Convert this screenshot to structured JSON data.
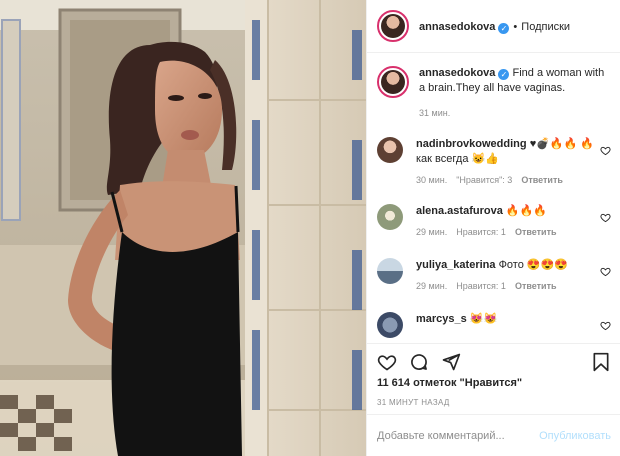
{
  "post": {
    "author": "annasedokova",
    "follow_label": "Подписки",
    "caption_text": "Find a woman with a brain.They all have vaginas.",
    "caption_time": "31 мин.",
    "likes_text": "11 614 отметок \"Нравится\"",
    "posted_time": "31 МИНУТ НАЗАД"
  },
  "comments": [
    {
      "user": "nadinbrovkowedding",
      "text": "♥💣🔥🔥 🔥как всегда 😺👍",
      "time": "30 мин.",
      "likes": "\"Нравится\": 3",
      "reply": "Ответить"
    },
    {
      "user": "alena.astafurova",
      "text": "🔥🔥🔥",
      "time": "29 мин.",
      "likes": "Нравится: 1",
      "reply": "Ответить"
    },
    {
      "user": "yuliya_katerina",
      "text": "Фото 😍😍😍",
      "time": "29 мин.",
      "likes": "Нравится: 1",
      "reply": "Ответить"
    },
    {
      "user": "marcys_s",
      "text": "😻😻",
      "time": "",
      "likes": "",
      "reply": ""
    }
  ],
  "add_comment": {
    "placeholder": "Добавьте комментарий...",
    "publish_label": "Опубликовать"
  },
  "icons": {
    "like": "heart-icon",
    "comment": "comment-icon",
    "share": "paper-plane-icon",
    "save": "bookmark-icon",
    "more": "more-options-icon",
    "verified": "verified-badge-icon"
  },
  "colors": {
    "text": "#262626",
    "muted": "#8e8e8e",
    "verified": "#3897f0",
    "publish_disabled": "#b2dffc",
    "dress": "#121212"
  }
}
